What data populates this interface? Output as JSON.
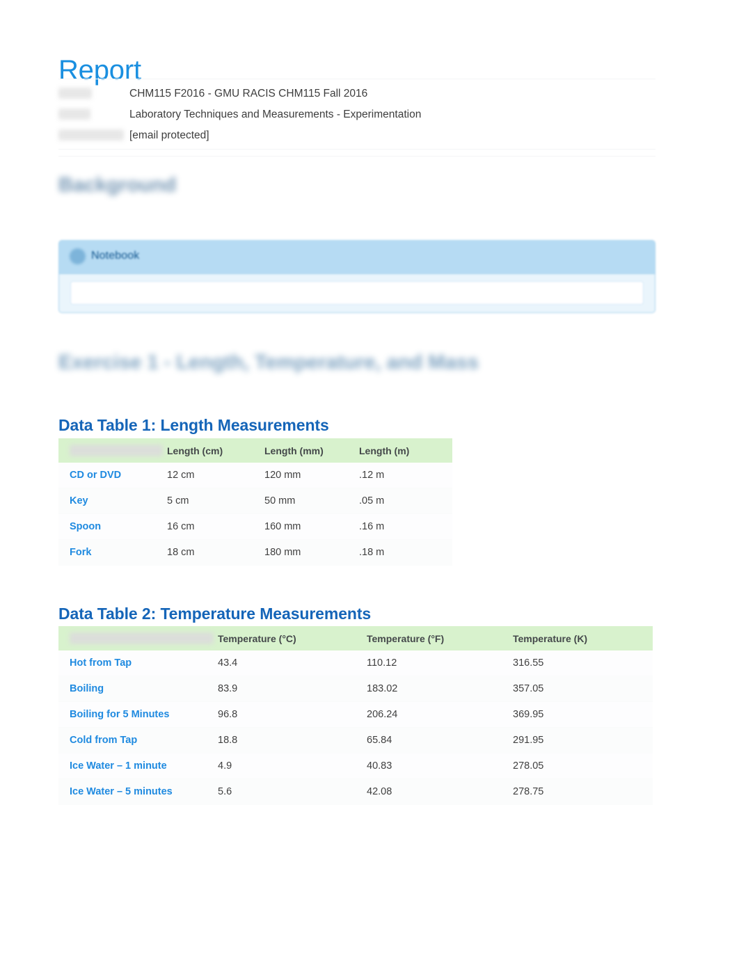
{
  "document": {
    "title": "Report"
  },
  "meta": {
    "rows": [
      {
        "label": "Course",
        "label_hidden": true,
        "value": "CHM115 F2016 - GMU RACIS CHM115 Fall 2016"
      },
      {
        "label": "Lesson",
        "label_hidden": true,
        "value": "Laboratory Techniques and Measurements - Experimentation"
      },
      {
        "label": "Student Name",
        "label_hidden": true,
        "value": "[email protected]"
      }
    ]
  },
  "sections": {
    "background_heading": "Background",
    "exercise_heading": "Exercise 1 - Length, Temperature, and Mass"
  },
  "notebook": {
    "label": "Notebook",
    "icon": "notebook-circle-icon",
    "input_value": "",
    "input_placeholder": ""
  },
  "table1": {
    "title": "Data Table 1: Length Measurements",
    "headers": [
      "",
      "Length (cm)",
      "Length (mm)",
      "Length (m)"
    ],
    "rows": [
      {
        "label": "CD or DVD",
        "values": [
          "12 cm",
          "120 mm",
          ".12 m"
        ]
      },
      {
        "label": "Key",
        "values": [
          "5 cm",
          "50 mm",
          ".05 m"
        ]
      },
      {
        "label": "Spoon",
        "values": [
          "16 cm",
          "160 mm",
          ".16 m"
        ]
      },
      {
        "label": "Fork",
        "values": [
          "18 cm",
          "180 mm",
          ".18 m"
        ]
      }
    ]
  },
  "table2": {
    "title": "Data Table 2: Temperature Measurements",
    "headers": [
      "",
      "Temperature (°C)",
      "Temperature (°F)",
      "Temperature (K)"
    ],
    "rows": [
      {
        "label": "Hot from Tap",
        "values": [
          "43.4",
          "110.12",
          "316.55"
        ]
      },
      {
        "label": "Boiling",
        "values": [
          "83.9",
          "183.02",
          "357.05"
        ]
      },
      {
        "label": "Boiling for 5 Minutes",
        "values": [
          "96.8",
          "206.24",
          "369.95"
        ]
      },
      {
        "label": "Cold from Tap",
        "values": [
          "18.8",
          "65.84",
          "291.95"
        ]
      },
      {
        "label": "Ice Water – 1 minute",
        "values": [
          "4.9",
          "40.83",
          "278.05"
        ]
      },
      {
        "label": "Ice Water – 5 minutes",
        "values": [
          "5.6",
          "42.08",
          "278.75"
        ]
      }
    ]
  },
  "colors": {
    "title_blue": "#1a8fe0",
    "heading_blue": "#1565b8",
    "row_label_blue": "#1f8ae0",
    "table_header_green": "#d8f2cd",
    "notebook_header_blue": "#b6dbf3",
    "notebook_border_blue": "#a9d3ee"
  }
}
